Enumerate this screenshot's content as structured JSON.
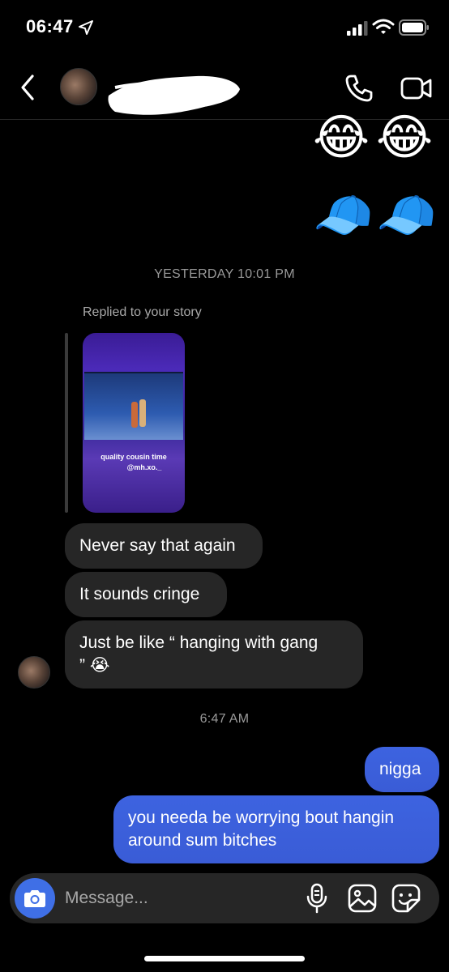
{
  "status_bar": {
    "time": "06:47"
  },
  "header": {
    "contact_name": ""
  },
  "messages": {
    "emoji_row_1": [
      "😂",
      "😂"
    ],
    "emoji_row_2": [
      "🧢",
      "🧢"
    ],
    "timestamp_1": "YESTERDAY 10:01 PM",
    "replied_label": "Replied to your story",
    "story": {
      "caption_line_1": "quality cousin time",
      "caption_line_2": "@mh.xo._"
    },
    "received": [
      "Never say that again",
      "It sounds cringe",
      "Just be like “ hanging with gang",
      "”"
    ],
    "received_emoji": "😭",
    "timestamp_2": "6:47 AM",
    "sent": [
      "nigga",
      "you needa be worrying bout hangin",
      "around sum bitches"
    ]
  },
  "composer": {
    "placeholder": "Message..."
  },
  "colors": {
    "sent_bubble": "#3b5bdb",
    "received_bubble": "#262626",
    "camera_button": "#3f6fe6",
    "background": "#000000"
  },
  "icons": [
    "location-arrow-icon",
    "signal-icon",
    "wifi-icon",
    "battery-icon",
    "back-icon",
    "phone-icon",
    "video-icon",
    "camera-icon",
    "microphone-icon",
    "gallery-icon",
    "sticker-icon"
  ]
}
